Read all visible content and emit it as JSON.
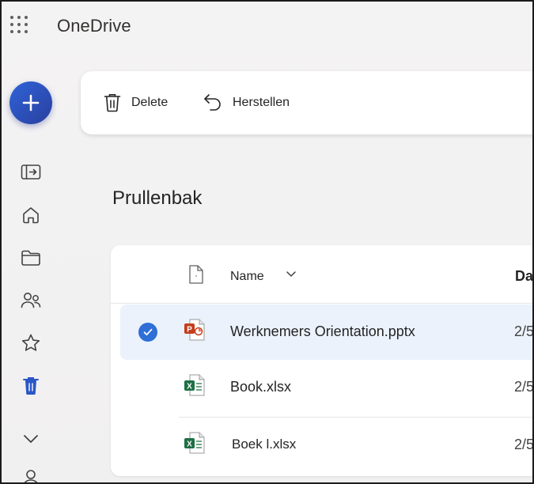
{
  "app": {
    "title": "OneDrive"
  },
  "commands": {
    "delete_label": "Delete",
    "restore_label": "Herstellen"
  },
  "page": {
    "title": "Prullenbak"
  },
  "list": {
    "columns": {
      "name": "Name",
      "date": "Da"
    },
    "rows": [
      {
        "name": "Werknemers Orientation.pptx",
        "date": "2/5",
        "type": "powerpoint-icon",
        "selected": true
      },
      {
        "name": "Book.xlsx",
        "date": "2/5",
        "type": "excel-icon",
        "selected": false
      },
      {
        "name": "Boek l.xlsx",
        "date": "2/5",
        "type": "excel-icon",
        "selected": false
      }
    ]
  },
  "colors": {
    "accent": "#2f6fd6",
    "fab_start": "#2f63d8",
    "fab_end": "#2a3f9e",
    "recycle_active": "#2a56c6",
    "powerpoint": "#c43e1c",
    "excel": "#1d7044"
  }
}
